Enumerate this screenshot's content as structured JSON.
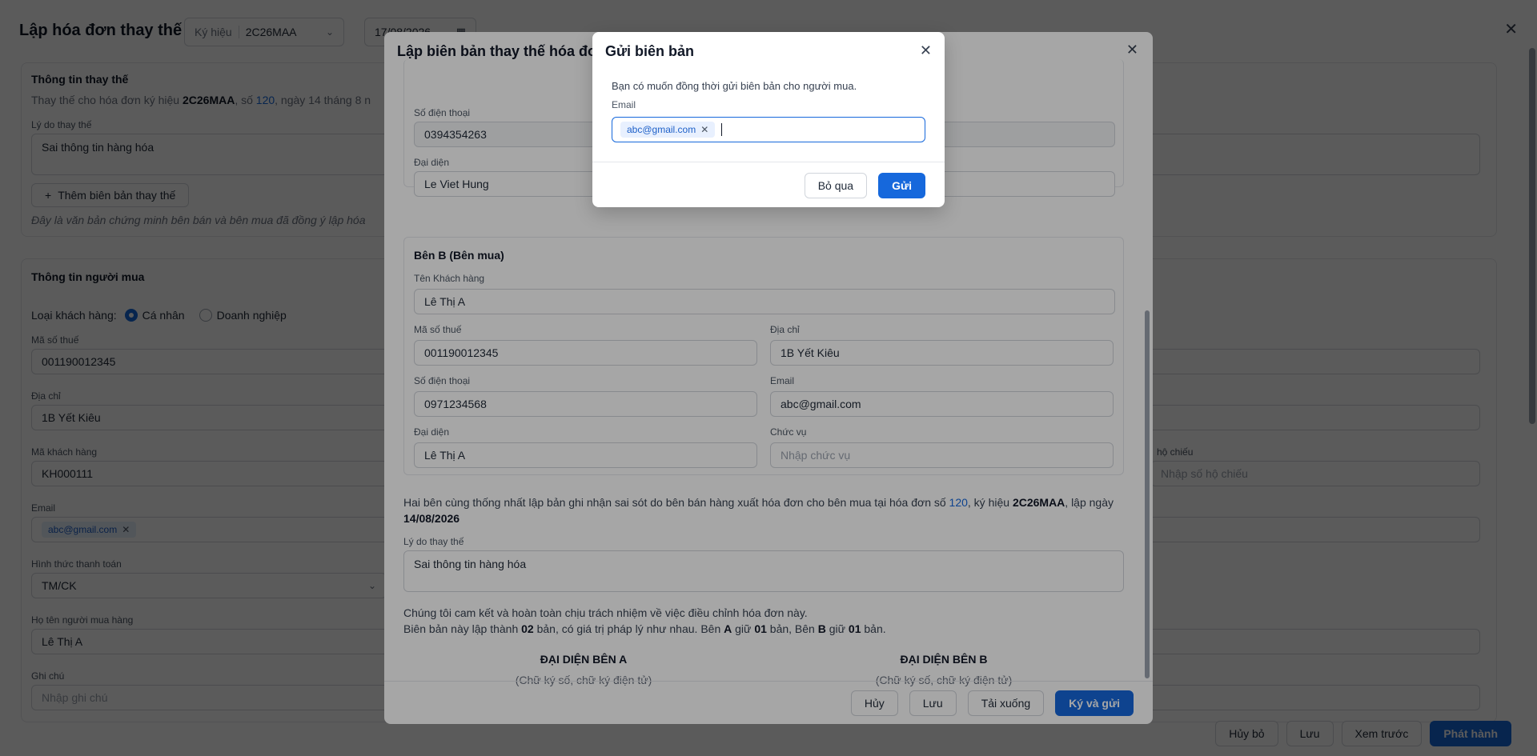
{
  "page": {
    "title": "Lập hóa đơn thay thế",
    "kyhieu_label": "Ký hiệu",
    "kyhieu_value": "2C26MAA",
    "date_value": "17/08/2026",
    "replace_section": {
      "title": "Thông tin thay thế",
      "desc_prefix": "Thay thế cho hóa đơn ký hiệu ",
      "desc_kyhieu": "2C26MAA",
      "desc_so": ", số ",
      "desc_number": "120",
      "desc_suffix": ", ngày 14 tháng 8 n",
      "reason_label": "Lý do thay thế",
      "reason_value": "Sai thông tin hàng hóa",
      "add_button": "Thêm biên bản thay thế",
      "note": "Đây là văn bản chứng minh bên bán và bên mua đã đồng ý lập hóa"
    },
    "buyer_section": {
      "title": "Thông tin người mua",
      "customer_type_label": "Loại khách hàng:",
      "customer_type_individual": "Cá nhân",
      "customer_type_business": "Doanh nghiệp",
      "tax_label": "Mã số thuế",
      "tax_value": "001190012345",
      "address_label": "Địa chỉ",
      "address_value": "1B Yết Kiêu",
      "customer_code_label": "Mã khách hàng",
      "customer_code_value": "KH000111",
      "passport_label": "hộ chiếu",
      "passport_placeholder": "Nhập số hộ chiếu",
      "email_label": "Email",
      "email_chip": "abc@gmail.com",
      "payment_label": "Hình thức thanh toán",
      "payment_value": "TM/CK",
      "buyer_name_label": "Họ tên người mua hàng",
      "buyer_name_value": "Lê Thị A",
      "note_label": "Ghi chú",
      "note_placeholder": "Nhập ghi chú"
    },
    "bottom_buttons": {
      "cancel": "Hủy bỏ",
      "save": "Lưu",
      "preview": "Xem trước",
      "issue": "Phát hành"
    }
  },
  "modal": {
    "title": "Lập biên bản thay thế hóa đơ",
    "party_a": {
      "phone_label": "Số điện thoại",
      "phone_value": "0394354263",
      "rep_label": "Đại diện",
      "rep_value": "Le Viet Hung"
    },
    "party_b": {
      "title": "Bên B (Bên mua)",
      "name_label": "Tên Khách hàng",
      "name_value": "Lê Thị A",
      "tax_label": "Mã số thuế",
      "tax_value": "001190012345",
      "address_label": "Địa chỉ",
      "address_value": "1B Yết Kiêu",
      "phone_label": "Số điện thoại",
      "phone_value": "0971234568",
      "email_label": "Email",
      "email_value": "abc@gmail.com",
      "rep_label": "Đại diện",
      "rep_value": "Lê Thị A",
      "position_label": "Chức vụ",
      "position_placeholder": "Nhập chức vụ"
    },
    "agreement": {
      "text1": "Hai bên cùng thống nhất lập bản ghi nhận sai sót do bên bán hàng xuất hóa đơn cho bên mua tại hóa đơn số ",
      "invoice_no": "120",
      "text2": ", ký hiệu ",
      "kyhieu": "2C26MAA",
      "text3": ", lập ngày ",
      "date": "14/08/2026"
    },
    "reason_label": "Lý do thay thế",
    "reason_value": "Sai thông tin hàng hóa",
    "commit_line1": "Chúng tôi cam kết và hoàn toàn chịu trách nhiệm về việc điều chỉnh hóa đơn này.",
    "commit2_a": "Biên bản này lập thành ",
    "commit2_copies": "02",
    "commit2_b": " bản, có giá trị pháp lý như nhau. Bên ",
    "commit2_partyA": "A",
    "commit2_c": " giữ ",
    "commit2_a_count": "01",
    "commit2_d": " bản, Bên ",
    "commit2_partyB": "B",
    "commit2_e": " giữ ",
    "commit2_b_count": "01",
    "commit2_f": " bản.",
    "sign_a_title": "ĐẠI DIỆN BÊN A",
    "sign_a_sub": "(Chữ ký số, chữ ký điện tử)",
    "sign_b_title": "ĐẠI DIỆN BÊN B",
    "sign_b_sub": "(Chữ ký số, chữ ký điện tử)",
    "footer": {
      "cancel": "Hủy",
      "save": "Lưu",
      "download": "Tải xuống",
      "sign_send": "Ký và gửi"
    }
  },
  "dialog": {
    "title": "Gửi biên bản",
    "message": "Bạn có muốn đồng thời gửi biên bản cho người mua.",
    "email_label": "Email",
    "email_chip": "abc@gmail.com",
    "skip_button": "Bỏ qua",
    "send_button": "Gửi"
  },
  "colors": {
    "primary": "#1668dc",
    "chip_bg": "#e8f0fe"
  }
}
